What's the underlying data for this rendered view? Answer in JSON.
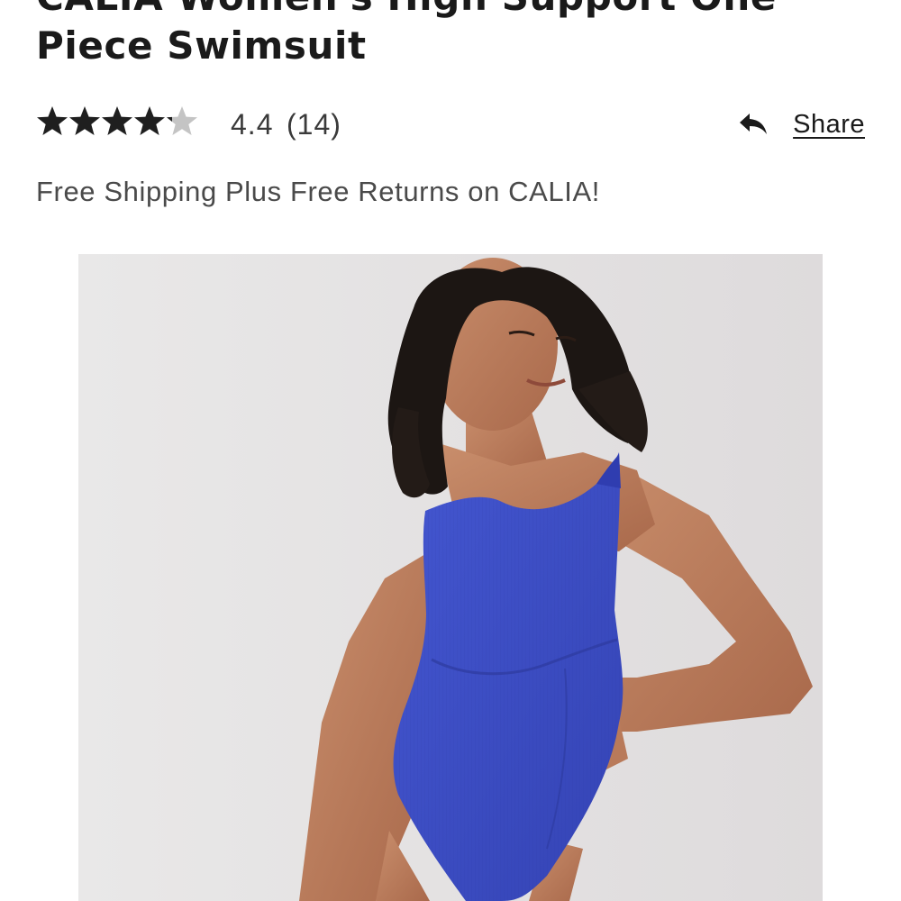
{
  "product": {
    "title": "CALIA Women's High Support One Piece Swimsuit",
    "rating_value": "4.4",
    "rating_count": "(14)",
    "rating_stars": 4.4,
    "shipping_message": "Free Shipping Plus Free Returns on CALIA!"
  },
  "share": {
    "label": "Share",
    "icon": "reply-arrow-icon"
  },
  "image": {
    "subject": "model-wearing-blue-swimsuit",
    "swimsuit_color": "#3d4fc4",
    "background_color": "#e4e2e3"
  },
  "colors": {
    "star_filled": "#1f1f1f",
    "star_empty": "#c4c4c4",
    "text": "#1a1a1a",
    "muted_text": "#4a4a4a"
  }
}
